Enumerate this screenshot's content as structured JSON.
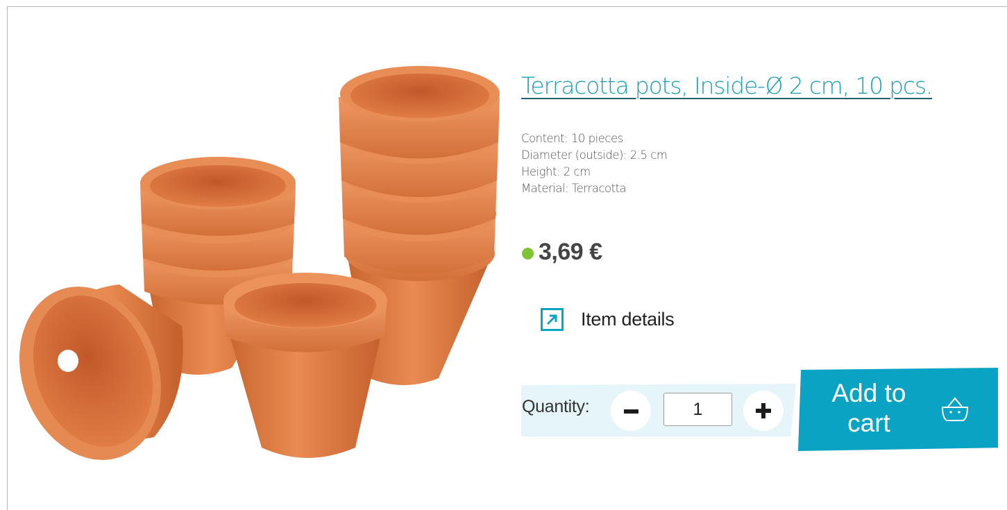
{
  "product": {
    "title": "Terracotta pots, Inside-Ø 2 cm, 10 pcs.",
    "specs": [
      "Content: 10 pieces",
      "Diameter (outside): 2.5 cm",
      "Height: 2 cm",
      "Material: Terracotta"
    ],
    "price": "3,69 €",
    "stock_color": "#7fc437"
  },
  "details": {
    "label": "Item details",
    "icon": "external-link-icon"
  },
  "quantity": {
    "label": "Quantity:",
    "value": "1",
    "minus_icon": "minus-icon",
    "plus_icon": "plus-icon"
  },
  "cart": {
    "label_line1": "Add to",
    "label_line2": "cart",
    "icon": "basket-icon",
    "color": "#0aa3c4"
  },
  "colors": {
    "accent": "#1aa0b7",
    "panel": "#e6f5f9",
    "terracotta": "#e0804a"
  }
}
